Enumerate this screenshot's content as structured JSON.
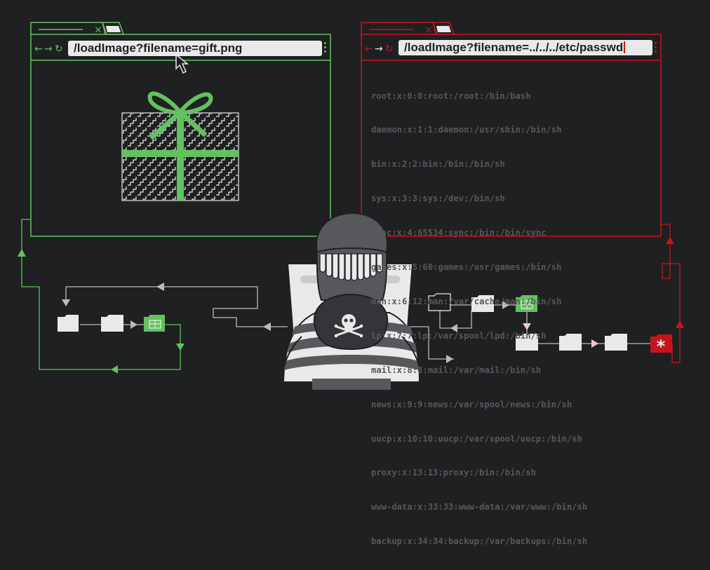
{
  "colors": {
    "background": "#1f2022",
    "safe_green": "#63c15f",
    "attack_red": "#c7141b",
    "passwd_text": "#56585b",
    "light": "#e8eaea"
  },
  "safe_window": {
    "tab_close": "×",
    "url": "/loadImage?filename=gift.png",
    "nav_back": "←",
    "nav_forward": "→",
    "nav_reload": "↻"
  },
  "attack_window": {
    "tab_close": "×",
    "url": "/loadImage?filename=../../../etc/passwd",
    "nav_back": "←",
    "nav_forward": "→",
    "nav_reload": "↻",
    "passwd_lines": [
      "root:x:0:0:root:/root:/bin/bash",
      "daemon:x:1:1:daemon:/usr/sbin:/bin/sh",
      "bin:x:2:2:bin:/bin:/bin/sh",
      "sys:x:3:3:sys:/dev:/bin/sh",
      "sync:x:4:65534:sync:/bin:/bin/sync",
      "games:x:5:60:games:/usr/games:/bin/sh",
      "man:x:6:12:man:/var/cache/man:/bin/sh",
      "lp:x:7:7:lp:/var/spool/lpd:/bin/sh",
      "mail:x:8:8:mail:/var/mail:/bin/sh",
      "news:x:9:9:news:/var/spool/news:/bin/sh",
      "uucp:x:10:10:uucp:/var/spool/uucp:/bin/sh",
      "proxy:x:13:13:proxy:/bin:/bin/sh",
      "www-data:x:33:33:www-data:/var/www:/bin/sh",
      "backup:x:34:34:backup:/var/backups:/bin/sh"
    ]
  },
  "icons": {
    "gift": "gift-icon",
    "cursor": "mouse-pointer-icon",
    "hacker": "hacker-illustration",
    "skull": "skull-crossbones-icon",
    "folder": "folder-icon",
    "image_file": "image-file-icon",
    "secret_file": "asterisk-file-icon"
  }
}
